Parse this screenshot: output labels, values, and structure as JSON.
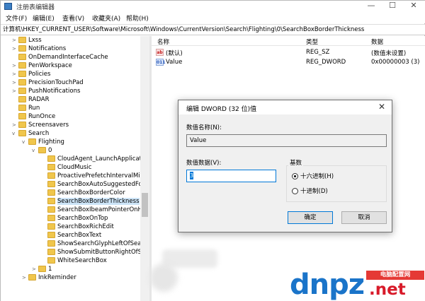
{
  "window": {
    "title": "注册表编辑器",
    "controls": {
      "minimize": "—",
      "maximize": "☐",
      "close": "✕"
    }
  },
  "menu": [
    "文件(F)",
    "编辑(E)",
    "查看(V)",
    "收藏夹(A)",
    "帮助(H)"
  ],
  "address": "计算机\\HKEY_CURRENT_USER\\Software\\Microsoft\\Windows\\CurrentVersion\\Search\\Flighting\\0\\SearchBoxBorderThickness",
  "tree": [
    {
      "label": "Lxss",
      "depth": 0,
      "exp": ">"
    },
    {
      "label": "Notifications",
      "depth": 0,
      "exp": ">"
    },
    {
      "label": "OnDemandInterfaceCache",
      "depth": 0,
      "exp": ""
    },
    {
      "label": "PenWorkspace",
      "depth": 0,
      "exp": ">"
    },
    {
      "label": "Policies",
      "depth": 0,
      "exp": ">"
    },
    {
      "label": "PrecisionTouchPad",
      "depth": 0,
      "exp": ">"
    },
    {
      "label": "PushNotifications",
      "depth": 0,
      "exp": ">"
    },
    {
      "label": "RADAR",
      "depth": 0,
      "exp": ""
    },
    {
      "label": "Run",
      "depth": 0,
      "exp": ""
    },
    {
      "label": "RunOnce",
      "depth": 0,
      "exp": ""
    },
    {
      "label": "Screensavers",
      "depth": 0,
      "exp": ">"
    },
    {
      "label": "Search",
      "depth": 0,
      "exp": "v"
    },
    {
      "label": "Flighting",
      "depth": 1,
      "exp": "v"
    },
    {
      "label": "0",
      "depth": 2,
      "exp": "v"
    },
    {
      "label": "CloudAgent_LaunchApplicati",
      "depth": 3,
      "exp": ""
    },
    {
      "label": "CloudMusic",
      "depth": 3,
      "exp": ""
    },
    {
      "label": "ProactivePrefetchIntervalMin",
      "depth": 3,
      "exp": ""
    },
    {
      "label": "SearchBoxAutoSuggestedFo",
      "depth": 3,
      "exp": ""
    },
    {
      "label": "SearchBoxBorderColor",
      "depth": 3,
      "exp": ""
    },
    {
      "label": "SearchBoxBorderThickness",
      "depth": 3,
      "exp": "",
      "selected": true
    },
    {
      "label": "SearchBoxIbeamPointerOnHo",
      "depth": 3,
      "exp": ""
    },
    {
      "label": "SearchBoxOnTop",
      "depth": 3,
      "exp": ""
    },
    {
      "label": "SearchBoxRichEdit",
      "depth": 3,
      "exp": ""
    },
    {
      "label": "SearchBoxText",
      "depth": 3,
      "exp": ""
    },
    {
      "label": "ShowSearchGlyphLeftOfSear",
      "depth": 3,
      "exp": ""
    },
    {
      "label": "ShowSubmitButtonRightOfSe",
      "depth": 3,
      "exp": ""
    },
    {
      "label": "WhiteSearchBox",
      "depth": 3,
      "exp": ""
    },
    {
      "label": "1",
      "depth": 2,
      "exp": ">"
    },
    {
      "label": "InkReminder",
      "depth": 1,
      "exp": ">"
    }
  ],
  "list": {
    "headers": {
      "name": "名称",
      "type": "类型",
      "data": "数据"
    },
    "rows": [
      {
        "icon": "ab",
        "name": "(默认)",
        "type": "REG_SZ",
        "data": "(数值未设置)"
      },
      {
        "icon": "011",
        "name": "Value",
        "type": "REG_DWORD",
        "data": "0x00000003 (3)"
      }
    ]
  },
  "dialog": {
    "title": "编辑 DWORD (32 位)值",
    "close": "✕",
    "value_name_label": "数值名称(N):",
    "value_name": "Value",
    "value_data_label": "数值数据(V):",
    "value_data": "3",
    "base_label": "基数",
    "hex_label": "十六进制(H)",
    "dec_label": "十进制(D)",
    "hex_selected": true,
    "ok": "确定",
    "cancel": "取消"
  },
  "watermark": {
    "logo": "dnpz",
    "tag": "电脑配置网",
    "domain": ".net"
  }
}
